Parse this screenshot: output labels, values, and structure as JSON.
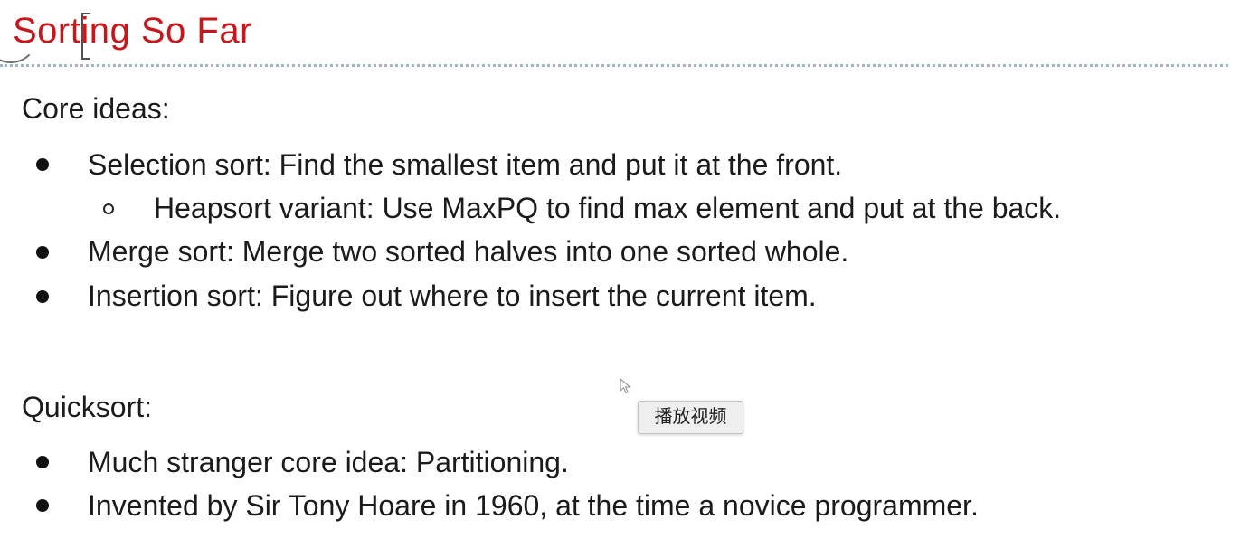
{
  "slide": {
    "title": "Sorting So Far",
    "sections": [
      {
        "heading": "Core ideas:",
        "items": [
          {
            "level": 1,
            "text": "Selection sort: Find the smallest item and put it at the front."
          },
          {
            "level": 2,
            "text": "Heapsort variant: Use MaxPQ to find max element and put at the back."
          },
          {
            "level": 1,
            "text": "Merge sort: Merge two sorted halves into one sorted whole."
          },
          {
            "level": 1,
            "text": "Insertion sort: Figure out where to insert the current item."
          }
        ]
      },
      {
        "heading": "Quicksort:",
        "items": [
          {
            "level": 1,
            "text": "Much stranger core idea: Partitioning."
          },
          {
            "level": 1,
            "text": "Invented by Sir Tony Hoare in 1960, at the time a novice programmer."
          }
        ]
      }
    ]
  },
  "tooltip": {
    "label": "播放视频"
  },
  "colors": {
    "title": "#c8161b",
    "divider": "#9bb4d4",
    "text": "#1b1b1b"
  },
  "icons": {
    "cursor": "mouse-pointer-icon"
  }
}
